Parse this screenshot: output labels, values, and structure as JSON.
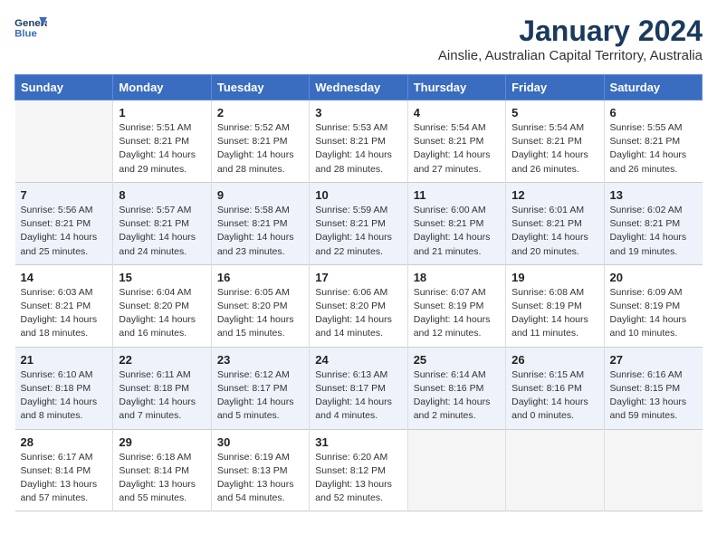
{
  "header": {
    "logo_line1": "General",
    "logo_line2": "Blue",
    "month_year": "January 2024",
    "location": "Ainslie, Australian Capital Territory, Australia"
  },
  "weekdays": [
    "Sunday",
    "Monday",
    "Tuesday",
    "Wednesday",
    "Thursday",
    "Friday",
    "Saturday"
  ],
  "weeks": [
    [
      {
        "day": "",
        "info": ""
      },
      {
        "day": "1",
        "info": "Sunrise: 5:51 AM\nSunset: 8:21 PM\nDaylight: 14 hours\nand 29 minutes."
      },
      {
        "day": "2",
        "info": "Sunrise: 5:52 AM\nSunset: 8:21 PM\nDaylight: 14 hours\nand 28 minutes."
      },
      {
        "day": "3",
        "info": "Sunrise: 5:53 AM\nSunset: 8:21 PM\nDaylight: 14 hours\nand 28 minutes."
      },
      {
        "day": "4",
        "info": "Sunrise: 5:54 AM\nSunset: 8:21 PM\nDaylight: 14 hours\nand 27 minutes."
      },
      {
        "day": "5",
        "info": "Sunrise: 5:54 AM\nSunset: 8:21 PM\nDaylight: 14 hours\nand 26 minutes."
      },
      {
        "day": "6",
        "info": "Sunrise: 5:55 AM\nSunset: 8:21 PM\nDaylight: 14 hours\nand 26 minutes."
      }
    ],
    [
      {
        "day": "7",
        "info": "Sunrise: 5:56 AM\nSunset: 8:21 PM\nDaylight: 14 hours\nand 25 minutes."
      },
      {
        "day": "8",
        "info": "Sunrise: 5:57 AM\nSunset: 8:21 PM\nDaylight: 14 hours\nand 24 minutes."
      },
      {
        "day": "9",
        "info": "Sunrise: 5:58 AM\nSunset: 8:21 PM\nDaylight: 14 hours\nand 23 minutes."
      },
      {
        "day": "10",
        "info": "Sunrise: 5:59 AM\nSunset: 8:21 PM\nDaylight: 14 hours\nand 22 minutes."
      },
      {
        "day": "11",
        "info": "Sunrise: 6:00 AM\nSunset: 8:21 PM\nDaylight: 14 hours\nand 21 minutes."
      },
      {
        "day": "12",
        "info": "Sunrise: 6:01 AM\nSunset: 8:21 PM\nDaylight: 14 hours\nand 20 minutes."
      },
      {
        "day": "13",
        "info": "Sunrise: 6:02 AM\nSunset: 8:21 PM\nDaylight: 14 hours\nand 19 minutes."
      }
    ],
    [
      {
        "day": "14",
        "info": "Sunrise: 6:03 AM\nSunset: 8:21 PM\nDaylight: 14 hours\nand 18 minutes."
      },
      {
        "day": "15",
        "info": "Sunrise: 6:04 AM\nSunset: 8:20 PM\nDaylight: 14 hours\nand 16 minutes."
      },
      {
        "day": "16",
        "info": "Sunrise: 6:05 AM\nSunset: 8:20 PM\nDaylight: 14 hours\nand 15 minutes."
      },
      {
        "day": "17",
        "info": "Sunrise: 6:06 AM\nSunset: 8:20 PM\nDaylight: 14 hours\nand 14 minutes."
      },
      {
        "day": "18",
        "info": "Sunrise: 6:07 AM\nSunset: 8:19 PM\nDaylight: 14 hours\nand 12 minutes."
      },
      {
        "day": "19",
        "info": "Sunrise: 6:08 AM\nSunset: 8:19 PM\nDaylight: 14 hours\nand 11 minutes."
      },
      {
        "day": "20",
        "info": "Sunrise: 6:09 AM\nSunset: 8:19 PM\nDaylight: 14 hours\nand 10 minutes."
      }
    ],
    [
      {
        "day": "21",
        "info": "Sunrise: 6:10 AM\nSunset: 8:18 PM\nDaylight: 14 hours\nand 8 minutes."
      },
      {
        "day": "22",
        "info": "Sunrise: 6:11 AM\nSunset: 8:18 PM\nDaylight: 14 hours\nand 7 minutes."
      },
      {
        "day": "23",
        "info": "Sunrise: 6:12 AM\nSunset: 8:17 PM\nDaylight: 14 hours\nand 5 minutes."
      },
      {
        "day": "24",
        "info": "Sunrise: 6:13 AM\nSunset: 8:17 PM\nDaylight: 14 hours\nand 4 minutes."
      },
      {
        "day": "25",
        "info": "Sunrise: 6:14 AM\nSunset: 8:16 PM\nDaylight: 14 hours\nand 2 minutes."
      },
      {
        "day": "26",
        "info": "Sunrise: 6:15 AM\nSunset: 8:16 PM\nDaylight: 14 hours\nand 0 minutes."
      },
      {
        "day": "27",
        "info": "Sunrise: 6:16 AM\nSunset: 8:15 PM\nDaylight: 13 hours\nand 59 minutes."
      }
    ],
    [
      {
        "day": "28",
        "info": "Sunrise: 6:17 AM\nSunset: 8:14 PM\nDaylight: 13 hours\nand 57 minutes."
      },
      {
        "day": "29",
        "info": "Sunrise: 6:18 AM\nSunset: 8:14 PM\nDaylight: 13 hours\nand 55 minutes."
      },
      {
        "day": "30",
        "info": "Sunrise: 6:19 AM\nSunset: 8:13 PM\nDaylight: 13 hours\nand 54 minutes."
      },
      {
        "day": "31",
        "info": "Sunrise: 6:20 AM\nSunset: 8:12 PM\nDaylight: 13 hours\nand 52 minutes."
      },
      {
        "day": "",
        "info": ""
      },
      {
        "day": "",
        "info": ""
      },
      {
        "day": "",
        "info": ""
      }
    ]
  ]
}
